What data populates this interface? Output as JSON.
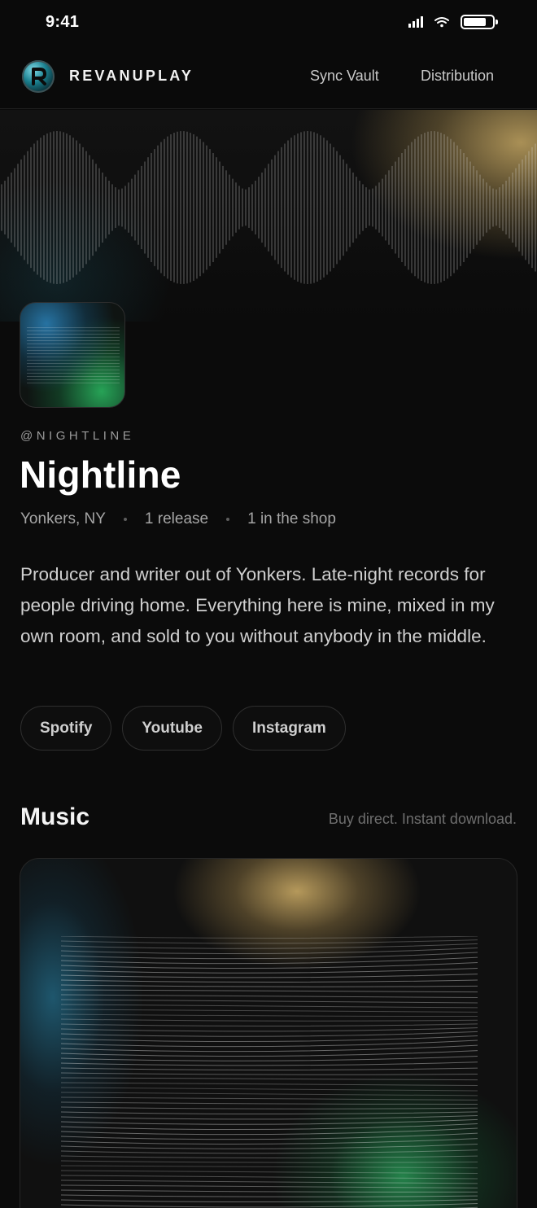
{
  "status_bar": {
    "time": "9:41"
  },
  "nav": {
    "brand": "REVANUPLAY",
    "links": [
      "Sync Vault",
      "Distribution"
    ]
  },
  "profile": {
    "handle": "@NIGHTLINE",
    "name": "Nightline",
    "location": "Yonkers, NY",
    "releases": "1 release",
    "shop": "1 in the shop",
    "bio": "Producer and writer out of Yonkers. Late-night records for people driving home. Everything here is mine, mixed in my own room, and sold to you without anybody in the middle.",
    "socials": [
      "Spotify",
      "Youtube",
      "Instagram"
    ]
  },
  "music": {
    "title": "Music",
    "subtitle": "Buy direct. Instant download."
  },
  "colors": {
    "background": "#0b0b0b",
    "accent_gold": "#c4a662",
    "accent_teal": "#2378a0",
    "accent_green": "#28a055"
  },
  "icons": [
    "signal-icon",
    "wifi-icon",
    "battery-icon",
    "brand-logo-icon"
  ]
}
